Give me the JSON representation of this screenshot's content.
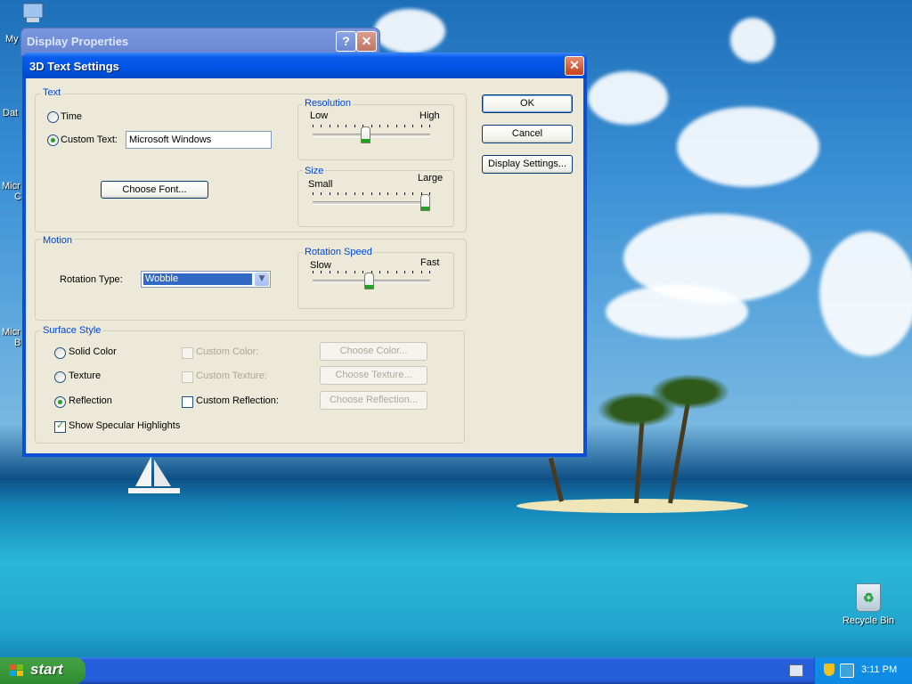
{
  "desktop": {
    "icons": [
      {
        "label": "My"
      },
      {
        "label": "Dat"
      },
      {
        "label": "Micr"
      },
      {
        "label": "C"
      },
      {
        "label": "Micr"
      },
      {
        "label": "B"
      }
    ],
    "recycle_bin": "Recycle Bin"
  },
  "background_window": {
    "title": "Display Properties",
    "help_btn": "?",
    "close_btn": "✕"
  },
  "dialog": {
    "title": "3D Text Settings",
    "close_btn": "✕",
    "text_group": {
      "label": "Text",
      "time_label": "Time",
      "custom_text_label": "Custom Text:",
      "custom_text_value": "Microsoft Windows",
      "selected": "custom_text",
      "choose_font": "Choose Font..."
    },
    "resolution": {
      "label": "Resolution",
      "low": "Low",
      "high": "High",
      "value_fraction": 0.45
    },
    "size": {
      "label": "Size",
      "small": "Small",
      "large": "Large",
      "value_fraction": 1.0
    },
    "motion": {
      "label": "Motion",
      "rotation_type_label": "Rotation Type:",
      "rotation_type_value": "Wobble"
    },
    "rotation_speed": {
      "label": "Rotation Speed",
      "slow": "Slow",
      "fast": "Fast",
      "value_fraction": 0.48
    },
    "surface": {
      "label": "Surface Style",
      "solid_color": "Solid Color",
      "texture": "Texture",
      "reflection": "Reflection",
      "selected": "reflection",
      "custom_color": "Custom Color:",
      "custom_texture": "Custom Texture:",
      "custom_reflection": "Custom Reflection:",
      "choose_color": "Choose Color...",
      "choose_texture": "Choose Texture...",
      "choose_reflection": "Choose Reflection...",
      "show_specular": "Show Specular Highlights",
      "show_specular_checked": true
    },
    "buttons": {
      "ok": "OK",
      "cancel": "Cancel",
      "display_settings": "Display Settings..."
    }
  },
  "taskbar": {
    "start": "start",
    "clock": "3:11 PM"
  }
}
